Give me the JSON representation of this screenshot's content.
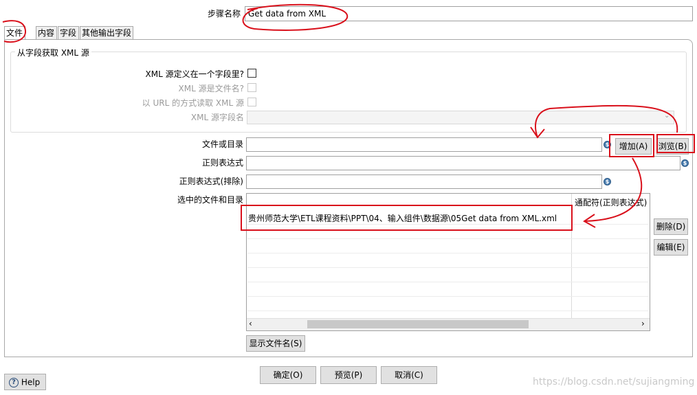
{
  "step": {
    "label": "步骤名称",
    "value": "Get data from XML"
  },
  "tabs": [
    {
      "label": "文件",
      "active": true
    },
    {
      "label": "内容",
      "active": false
    },
    {
      "label": "字段",
      "active": false
    },
    {
      "label": "其他输出字段",
      "active": false
    }
  ],
  "group": {
    "title": "从字段获取 XML 源",
    "xml_in_field": "XML 源定义在一个字段里?",
    "xml_is_file": "XML 源是文件名?",
    "read_url": "以 URL 的方式读取 XML 源",
    "field_name_label": "XML 源字段名"
  },
  "file": {
    "file_or_dir_label": "文件或目录",
    "regex_label": "正则表达式",
    "regex_exclude_label": "正则表达式(排除)",
    "selected_label": "选中的文件和目录",
    "add_button": "增加(A)",
    "browse_button": "浏览(B)"
  },
  "table": {
    "columns": [
      "",
      "通配符(正则表达式)"
    ],
    "rows": [
      {
        "file": "贵州师范大学\\ETL课程资料\\PPT\\04、输入组件\\数据源\\05Get data from XML.xml",
        "wildcard": ""
      }
    ]
  },
  "side_buttons": {
    "delete": "删除(D)",
    "edit": "编辑(E)"
  },
  "show_filenames_button": "显示文件名(S)",
  "footer": {
    "ok": "确定(O)",
    "preview": "预览(P)",
    "cancel": "取消(C)",
    "help": "Help"
  },
  "watermark": "https://blog.csdn.net/sujiangming",
  "colors": {
    "annotation_red": "#d9101b",
    "var_icon_blue": "#4b7eb0"
  },
  "icons": {
    "variable": "variable-dollar-icon",
    "help": "help-circle-icon"
  }
}
